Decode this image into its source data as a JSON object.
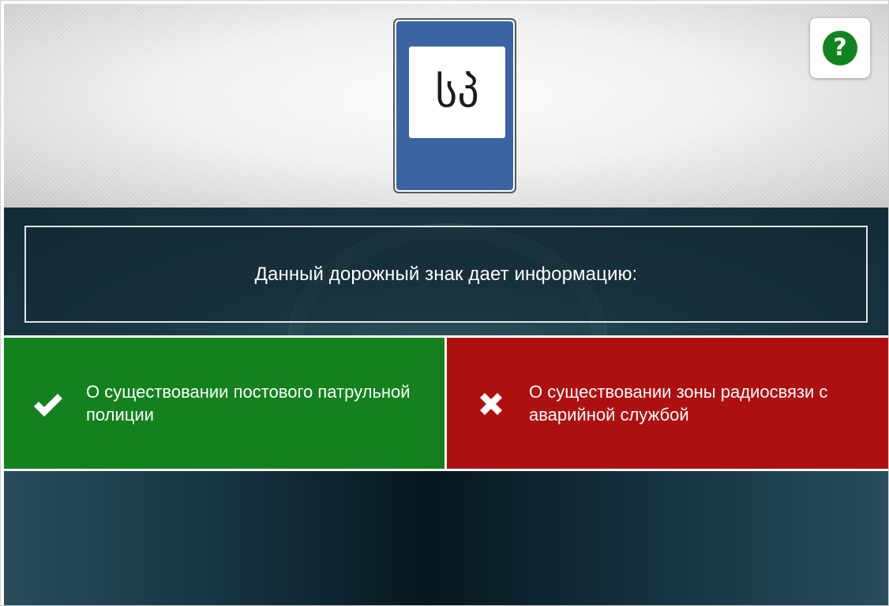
{
  "sign": {
    "text": "სპ",
    "colors": {
      "background": "#3a64a2",
      "plate": "#ffffff",
      "border": "#55585c"
    }
  },
  "help": {
    "icon": "question-icon",
    "symbol": "?",
    "color": "#12841f"
  },
  "question": {
    "text": "Данный дорожный знак дает информацию:"
  },
  "answers": [
    {
      "text": "О существовании постового патрульной полиции",
      "state": "correct",
      "icon": "checkmark-icon",
      "color": "#13821e"
    },
    {
      "text": "О существовании зоны радиосвязи с аварийной службой",
      "state": "wrong",
      "icon": "cross-icon",
      "color": "#ae1010"
    }
  ]
}
